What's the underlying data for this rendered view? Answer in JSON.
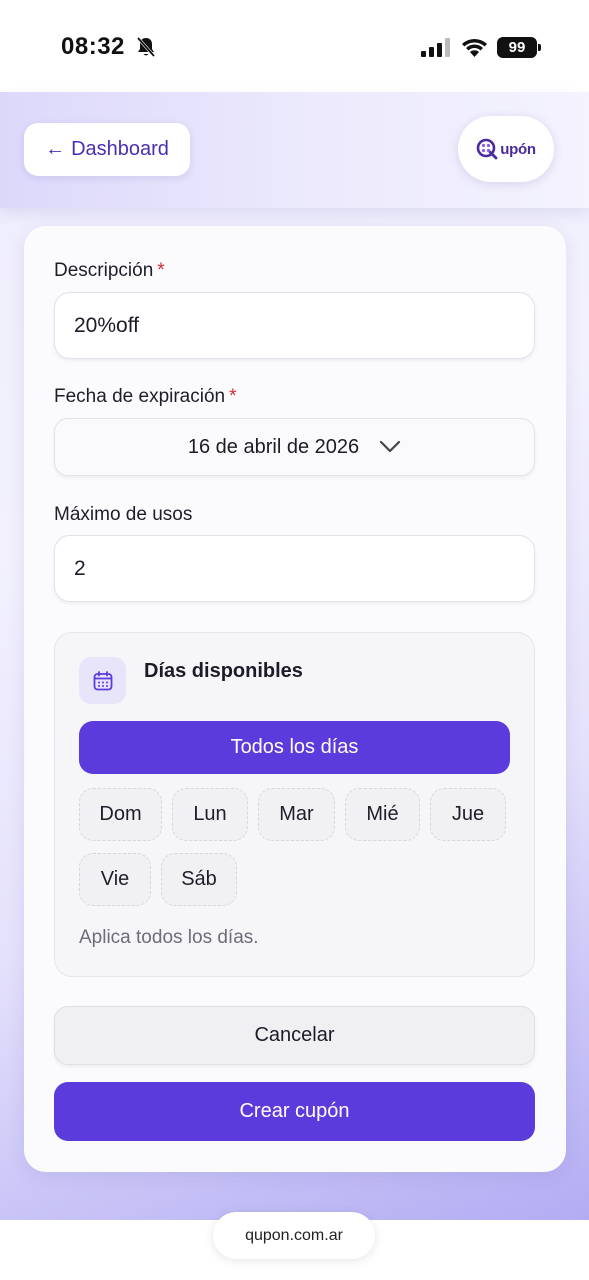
{
  "status_bar": {
    "time": "08:32",
    "battery": "99"
  },
  "header": {
    "back_arrow": "←",
    "back_label": "Dashboard",
    "logo_text": "upón"
  },
  "form": {
    "description": {
      "label": "Descripción",
      "required_mark": "*",
      "value": "20%off"
    },
    "expiration": {
      "label": "Fecha de expiración",
      "required_mark": "*",
      "value": "16 de abril de 2026"
    },
    "max_uses": {
      "label": "Máximo de usos",
      "value": "2"
    },
    "days": {
      "title": "Días disponibles",
      "all_days_label": "Todos los días",
      "items": [
        {
          "label": "Dom"
        },
        {
          "label": "Lun"
        },
        {
          "label": "Mar"
        },
        {
          "label": "Mié"
        },
        {
          "label": "Jue"
        },
        {
          "label": "Vie"
        },
        {
          "label": "Sáb"
        }
      ],
      "help_text": "Aplica todos los días."
    },
    "cancel_label": "Cancelar",
    "submit_label": "Crear cupón"
  },
  "browser": {
    "url": "qupon.com.ar"
  },
  "colors": {
    "accent": "#5b3bdb",
    "required": "#d62b2b",
    "link": "#4a2fb5"
  }
}
